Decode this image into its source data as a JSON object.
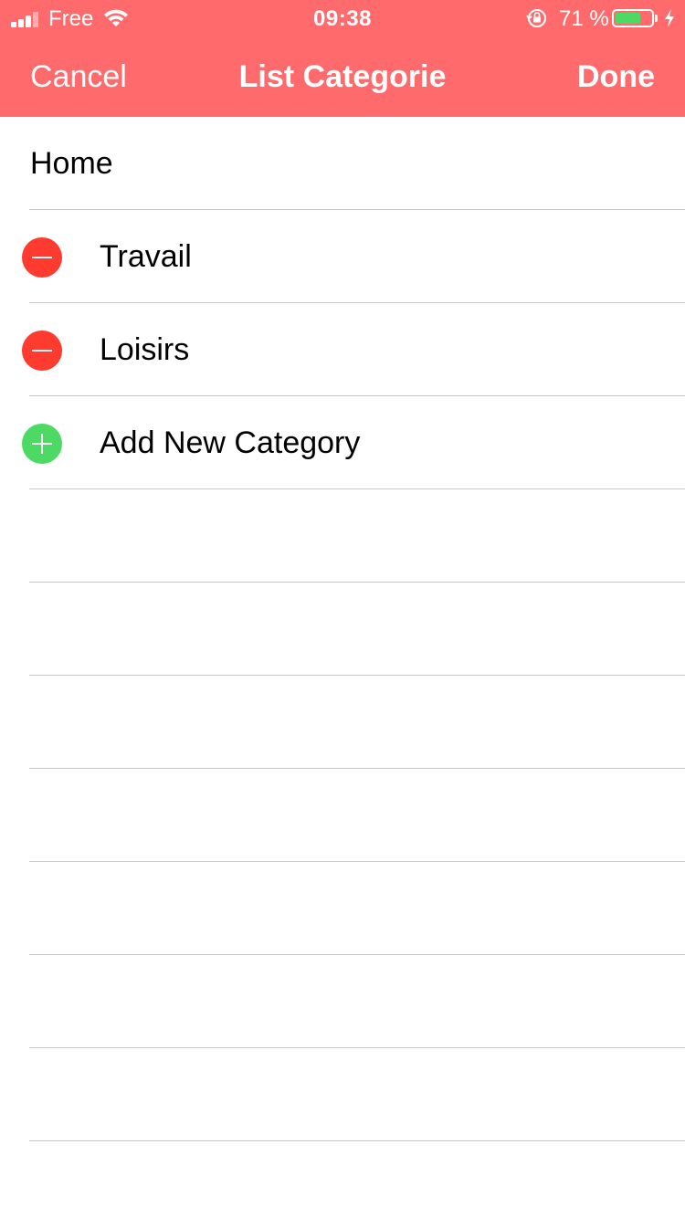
{
  "status_bar": {
    "carrier": "Free",
    "time": "09:38",
    "battery_percent": "71 %",
    "battery_level": 0.71,
    "signal_bars_filled": 3,
    "icons": [
      "signal-icon",
      "wifi-icon",
      "orientation-lock-icon",
      "battery-icon",
      "charging-icon"
    ]
  },
  "nav": {
    "cancel_label": "Cancel",
    "title": "List Categorie",
    "done_label": "Done"
  },
  "list": {
    "items": [
      {
        "label": "Home",
        "editing_control": "none"
      },
      {
        "label": "Travail",
        "editing_control": "delete"
      },
      {
        "label": "Loisirs",
        "editing_control": "delete"
      },
      {
        "label": "Add New Category",
        "editing_control": "insert"
      }
    ]
  },
  "colors": {
    "header_background": "#ff6b6d",
    "delete_red": "#ff3b30",
    "insert_green": "#4cd964",
    "separator": "#c8c7cc"
  }
}
